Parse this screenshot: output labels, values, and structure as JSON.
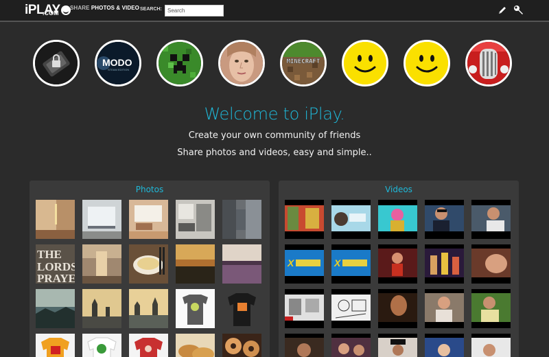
{
  "header": {
    "logo_main": "iPLAY",
    "logo_com": ".COM",
    "tagline_share": "SHARE",
    "tagline_rest": "PHOTOS & VIDEO",
    "search_label": "SEARCH:",
    "search_placeholder": "Search",
    "tools": [
      "pencil-icon",
      "wrench-icon"
    ]
  },
  "avatars": [
    {
      "name": "lock-avatar",
      "text": ""
    },
    {
      "name": "modo-avatar",
      "text": "MODO"
    },
    {
      "name": "creeper-avatar",
      "text": ""
    },
    {
      "name": "face-avatar",
      "text": ""
    },
    {
      "name": "minecraft-avatar",
      "text": "MINECRAFT"
    },
    {
      "name": "smiley-avatar",
      "text": ""
    },
    {
      "name": "smiley-avatar",
      "text": ""
    },
    {
      "name": "car-grille-avatar",
      "text": ""
    }
  ],
  "welcome": {
    "title": "Welcome to iPlay.",
    "line1": "Create your own community of friends",
    "line2": "Share photos and videos, easy and simple.."
  },
  "photos": {
    "title": "Photos"
  },
  "videos": {
    "title": "Videos"
  },
  "colors": {
    "accent": "#1fb8d8",
    "background": "#2b2b2b",
    "panel": "#3a3a3a"
  }
}
